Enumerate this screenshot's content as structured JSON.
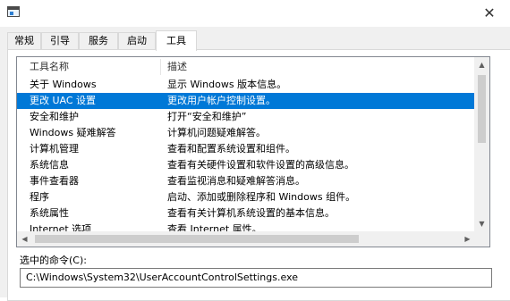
{
  "window": {
    "close_glyph": "✕",
    "icon": "msconfig-window-icon"
  },
  "tabs": [
    {
      "label": "常规",
      "active": false
    },
    {
      "label": "引导",
      "active": false
    },
    {
      "label": "服务",
      "active": false
    },
    {
      "label": "启动",
      "active": false
    },
    {
      "label": "工具",
      "active": true
    }
  ],
  "tools_list": {
    "columns": [
      "工具名称",
      "描述"
    ],
    "rows": [
      {
        "name": "关于 Windows",
        "desc": "显示 Windows 版本信息。",
        "selected": false
      },
      {
        "name": "更改 UAC 设置",
        "desc": "更改用户帐户控制设置。",
        "selected": true
      },
      {
        "name": "安全和维护",
        "desc": "打开“安全和维护”",
        "selected": false
      },
      {
        "name": "Windows 疑难解答",
        "desc": "计算机问题疑难解答。",
        "selected": false
      },
      {
        "name": "计算机管理",
        "desc": "查看和配置系统设置和组件。",
        "selected": false
      },
      {
        "name": "系统信息",
        "desc": "查看有关硬件设置和软件设置的高级信息。",
        "selected": false
      },
      {
        "name": "事件查看器",
        "desc": "查看监视消息和疑难解答消息。",
        "selected": false
      },
      {
        "name": "程序",
        "desc": "启动、添加或删除程序和 Windows 组件。",
        "selected": false
      },
      {
        "name": "系统属性",
        "desc": "查看有关计算机系统设置的基本信息。",
        "selected": false
      },
      {
        "name": "Internet 选项",
        "desc": "查看 Internet 属性。",
        "selected": false
      }
    ],
    "scroll": {
      "up": "▲",
      "down": "▼",
      "left": "◀",
      "right": "▶"
    }
  },
  "selected_command": {
    "label": "选中的命令(C):",
    "value": "C:\\Windows\\System32\\UserAccountControlSettings.exe"
  },
  "colors": {
    "selection": "#0078d7",
    "selection_text": "#ffffff"
  }
}
